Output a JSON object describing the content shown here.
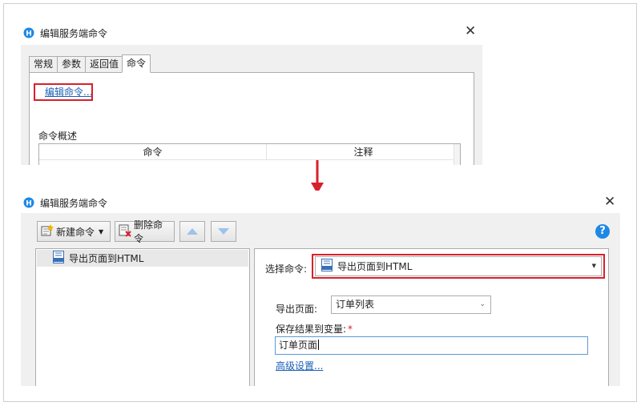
{
  "top_dialog": {
    "title": "编辑服务端命令",
    "close_glyph": "✕",
    "tabs": [
      "常规",
      "参数",
      "返回值",
      "命令"
    ],
    "active_tab": "命令",
    "edit_link": "编辑命令...",
    "overview_label": "命令概述",
    "table_headers": [
      "命令",
      "注释"
    ]
  },
  "bottom_dialog": {
    "title": "编辑服务端命令",
    "close_glyph": "✕",
    "toolbar": {
      "new_label": "新建命令",
      "new_caret": "▼",
      "delete_label": "删除命令",
      "move_up_icon": "triangle-up-icon",
      "move_down_icon": "triangle-down-icon"
    },
    "help_glyph": "?",
    "command_list": [
      {
        "icon": "html-export-icon",
        "label": "导出页面到HTML"
      }
    ],
    "select_command_label": "选择命令:",
    "select_command_value": "导出页面到HTML",
    "export_page_label": "导出页面:",
    "export_page_value": "订单列表",
    "save_result_label": "保存结果到变量:",
    "required_mark": "*",
    "save_result_value": "订单页面",
    "advanced_link": "高级设置..."
  },
  "colors": {
    "highlight": "#d9202b",
    "link": "#1a5fb4",
    "help": "#1e88e5",
    "arrow": "#d9202b"
  }
}
